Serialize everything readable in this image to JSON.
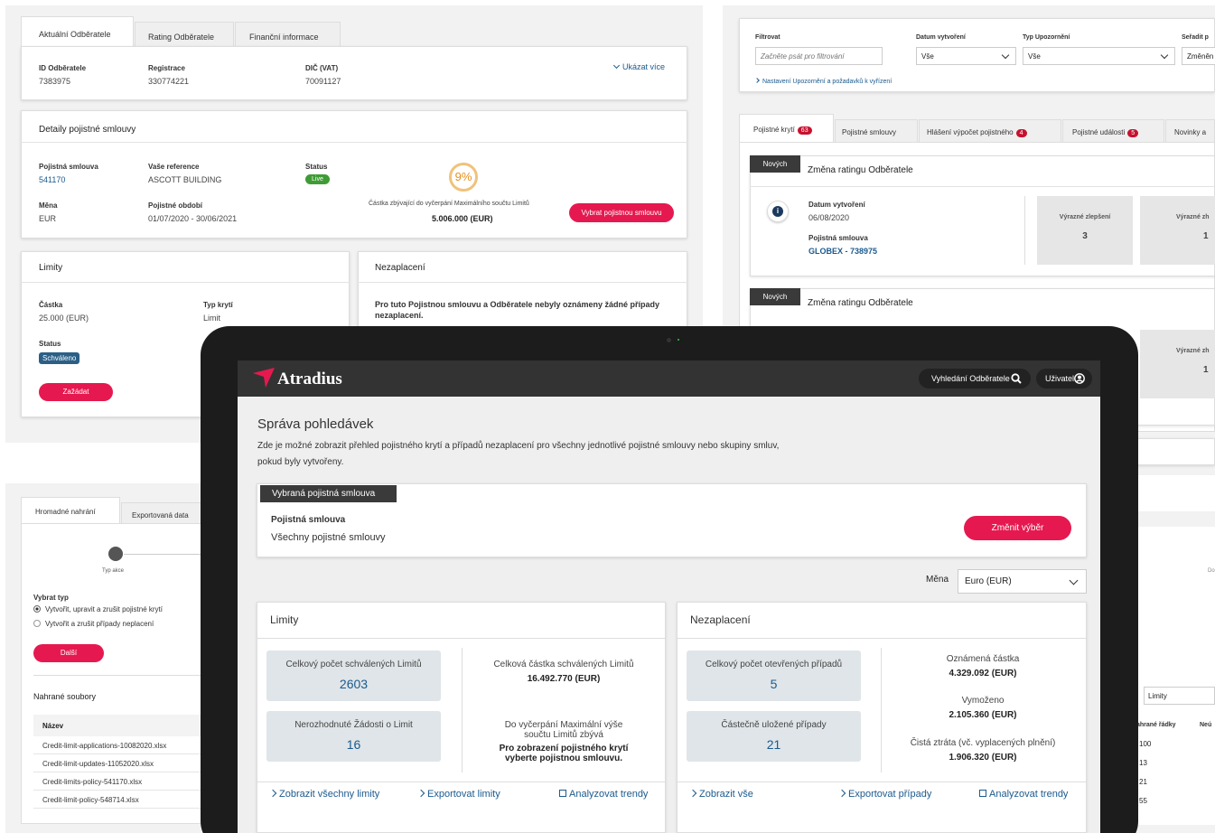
{
  "customer_panel": {
    "tabs": [
      "Aktuální Odběratele",
      "Rating Odběratele",
      "Finanční informace"
    ],
    "id_label": "ID Odběratele",
    "id_value": "7383975",
    "reg_label": "Registrace",
    "reg_value": "330774221",
    "vat_label": "DIČ (VAT)",
    "vat_value": "70091127",
    "show_more": "Ukázat více"
  },
  "policy_details": {
    "title": "Detaily pojistné smlouvy",
    "policy_label": "Pojistná smlouva",
    "policy_value": "541170",
    "ref_label": "Vaše reference",
    "ref_value": "ASCOTT BUILDING",
    "status_label": "Status",
    "status_value": "Live",
    "percent": "9%",
    "remaining_label": "Částka zbývající do vyčerpání Maximálního součtu Limitů",
    "remaining_value": "5.006.000 (EUR)",
    "currency_label": "Měna",
    "currency_value": "EUR",
    "period_label": "Pojistné období",
    "period_value": "01/07/2020 - 30/06/2021",
    "select_btn": "Vybrat pojistnou smlouvu"
  },
  "limits_card": {
    "title": "Limity",
    "amount_label": "Částka",
    "amount_value": "25.000 (EUR)",
    "type_label": "Typ krytí",
    "type_value": "Limit",
    "status_label": "Status",
    "status_value": "Schváleno",
    "request_btn": "Zažádat"
  },
  "nonpayment_card": {
    "title": "Nezaplacení",
    "text": "Pro tuto Pojistnou smlouvu a Odběratele nebyly oznámeny žádné případy nezaplacení."
  },
  "filter_panel": {
    "filter_label": "Filtrovat",
    "filter_placeholder": "Začněte psát pro filtrování",
    "date_label": "Datum vytvoření",
    "date_value": "Vše",
    "type_label": "Typ Upozornění",
    "type_value": "Vše",
    "sort_label": "Seřadit p",
    "sort_value": "Změněn",
    "settings_link": "Nastavení Upozornění a požadavků k vyřízení"
  },
  "notif_tabs": [
    {
      "label": "Pojistné krytí",
      "badge": "63"
    },
    {
      "label": "Pojistné smlouvy",
      "badge": ""
    },
    {
      "label": "Hlášení výpočet pojistného",
      "badge": "4"
    },
    {
      "label": "Pojistné události",
      "badge": "5"
    },
    {
      "label": "Novinky a",
      "badge": ""
    }
  ],
  "notif1": {
    "tag": "Nových",
    "title": "Změna ratingu Odběratele",
    "date_label": "Datum vytvoření",
    "date_value": "06/08/2020",
    "policy_label": "Pojistná smlouva",
    "policy_value": "GLOBEX - 738975",
    "box1_label": "Výrazné zlepšení",
    "box1_value": "3",
    "box2_label": "Výrazné zh",
    "box2_value": "1"
  },
  "notif2": {
    "tag": "Nových",
    "title": "Změna ratingu Odběratele",
    "box2_label": "Výrazné zh",
    "box2_value": "1"
  },
  "upload_panel": {
    "tabs": [
      "Hromadné nahrání",
      "Exportovaná data"
    ],
    "step_label": "Typ akce",
    "choose_label": "Vybrat typ",
    "option1": "Vytvořit, upravit a zrušit pojistné krytí",
    "option2": "Vytvořit a zrušit případy neplacení",
    "next_btn": "Další",
    "files_title": "Nahrané soubory",
    "col_name": "Název",
    "files": [
      "Credit-limit-applications-10082020.xlsx",
      "Credit-limit-updates-11052020.xlsx",
      "Credit-limits-policy-541170.xlsx",
      "Credit-limit-policy-548714.xlsx"
    ]
  },
  "right_bottom": {
    "step_label": "Do",
    "select_value": "Limity",
    "col1": "ahrané řádky",
    "col2": "Neú",
    "rows": [
      "100",
      "13",
      "21",
      "55"
    ]
  },
  "app": {
    "logo": "Atradius",
    "search_btn": "Vyhledání Odběratele",
    "user_btn": "Uživatel",
    "page_title": "Správa pohledávek",
    "intro": "Zde je možné zobrazit přehled pojistného krytí a případů nezaplacení pro všechny jednotlivé pojistné smlouvy nebo skupiny smluv, pokud byly vytvořeny.",
    "selected_tag": "Vybraná pojistná smlouva",
    "selected_label": "Pojistná smlouva",
    "selected_value": "Všechny pojistné smlouvy",
    "change_btn": "Změnit výběr",
    "currency_label": "Měna",
    "currency_value": "Euro (EUR)",
    "limits": {
      "title": "Limity",
      "approved_count_label": "Celkový počet schválených Limitů",
      "approved_count": "2603",
      "pending_label": "Nerozhodnuté Žádosti o Limit",
      "pending_count": "16",
      "approved_amount_label": "Celková částka schválených Limitů",
      "approved_amount": "16.492.770 (EUR)",
      "max_label": "Do vyčerpání Maximální výše součtu Limitů zbývá",
      "max_value": "Pro zobrazení pojistného krytí vyberte pojistnou smlouvu.",
      "link_all": "Zobrazit všechny limity",
      "link_export": "Exportovat limity",
      "link_trends": "Analyzovat trendy"
    },
    "nonpayment": {
      "title": "Nezaplacení",
      "open_label": "Celkový počet otevřených případů",
      "open_count": "5",
      "partial_label": "Částečně uložené případy",
      "partial_count": "21",
      "reported_label": "Oznámená částka",
      "reported_value": "4.329.092 (EUR)",
      "recovered_label": "Vymoženo",
      "recovered_value": "2.105.360 (EUR)",
      "netloss_label": "Čistá ztráta (vč. vyplacených plnění)",
      "netloss_value": "1.906.320 (EUR)",
      "link_all": "Zobrazit vše",
      "link_export": "Exportovat případy",
      "link_trends": "Analyzovat trendy"
    }
  }
}
